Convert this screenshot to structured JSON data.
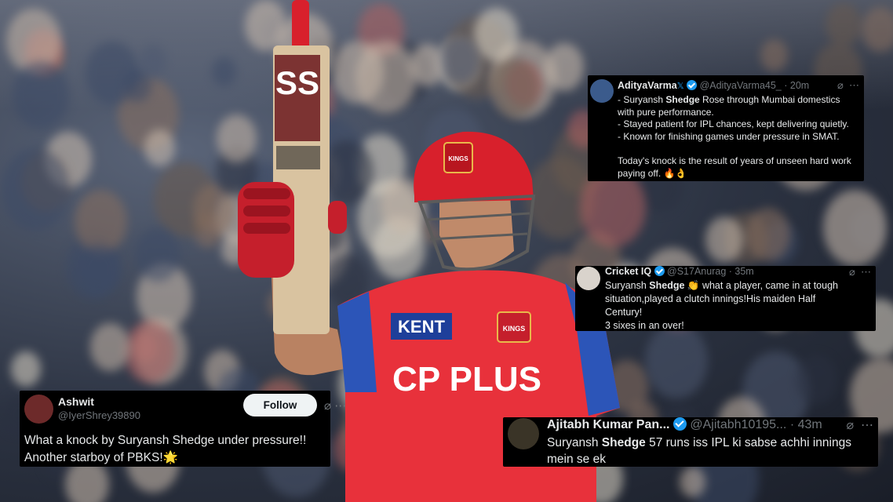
{
  "photo": {
    "bat_marking": "SS",
    "helmet_text": "KINGS",
    "jersey_sponsor_chest": "KENT",
    "jersey_sponsor_main": "CP PLUS",
    "jersey_badge": "KINGS",
    "colors": {
      "jersey_red": "#e8313b",
      "jersey_blue": "#2c55b8",
      "helmet_red": "#d8202c"
    }
  },
  "tweets": [
    {
      "id": "card1",
      "name": "AdityaVarma",
      "handle": "@AdityaVarma45_",
      "time": "20m",
      "lines": [
        [
          "- Suryansh ",
          "Shedge",
          " Rose through Mumbai domestics"
        ],
        [
          "with pure performance."
        ],
        [
          "- Stayed patient for IPL chances, kept delivering quietly."
        ],
        [
          "- Known for finishing games under pressure in SMAT."
        ],
        [
          ""
        ],
        [
          "Today's knock is the result of years of unseen hard work"
        ],
        [
          "paying off. 🔥👌"
        ]
      ]
    },
    {
      "id": "card2",
      "name": "Cricket IQ",
      "handle": "@S17Anurag",
      "time": "35m",
      "lines": [
        [
          "Suryansh ",
          "Shedge",
          " 👏 what a player, came in at tough"
        ],
        [
          "situation,played a clutch innings!His maiden Half"
        ],
        [
          "Century!"
        ],
        [
          "3 sixes in an over!"
        ]
      ]
    },
    {
      "id": "card3",
      "name": "Ashwit",
      "handle": "@IyerShrey39890",
      "follow_label": "Follow",
      "lines": [
        [
          "What a knock by Suryansh Shedge under pressure!!"
        ],
        [
          "Another starboy of PBKS!🌟"
        ]
      ]
    },
    {
      "id": "card4",
      "name": "Ajitabh Kumar Pan...",
      "handle": "@Ajitabh10195...",
      "time": "43m",
      "lines": [
        [
          "Suryansh ",
          "Shedge",
          " 57 runs iss IPL ki sabse achhi innings"
        ],
        [
          "mein se ek"
        ]
      ]
    }
  ],
  "icons": {
    "grok": "grok-icon",
    "more": "more-icon",
    "verified": "verified-badge-icon"
  }
}
